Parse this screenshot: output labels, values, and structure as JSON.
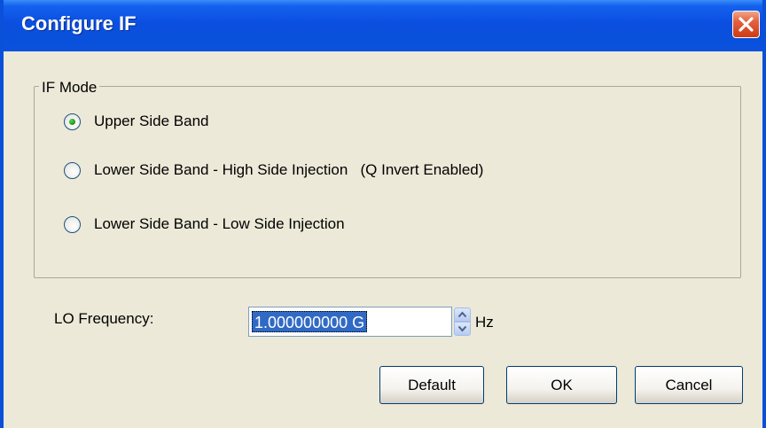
{
  "window": {
    "title": "Configure IF",
    "colors": {
      "titlebar": "#0a53de",
      "close": "#d9481f",
      "face": "#ece9d8",
      "selection": "#316ac5"
    }
  },
  "if_mode": {
    "group_label": "IF Mode",
    "options": [
      {
        "label": "Upper Side Band",
        "selected": true
      },
      {
        "label": "Lower Side Band - High Side Injection   (Q Invert Enabled)",
        "selected": false
      },
      {
        "label": "Lower Side Band - Low Side Injection",
        "selected": false
      }
    ]
  },
  "lo_frequency": {
    "label": "LO Frequency:",
    "value": "1.000000000 G",
    "unit": "Hz"
  },
  "buttons": {
    "default_label": "Default",
    "ok_label": "OK",
    "cancel_label": "Cancel"
  },
  "icons": {
    "close": "close-icon",
    "spin_up": "spin-up-arrow-icon",
    "spin_down": "spin-down-arrow-icon"
  }
}
